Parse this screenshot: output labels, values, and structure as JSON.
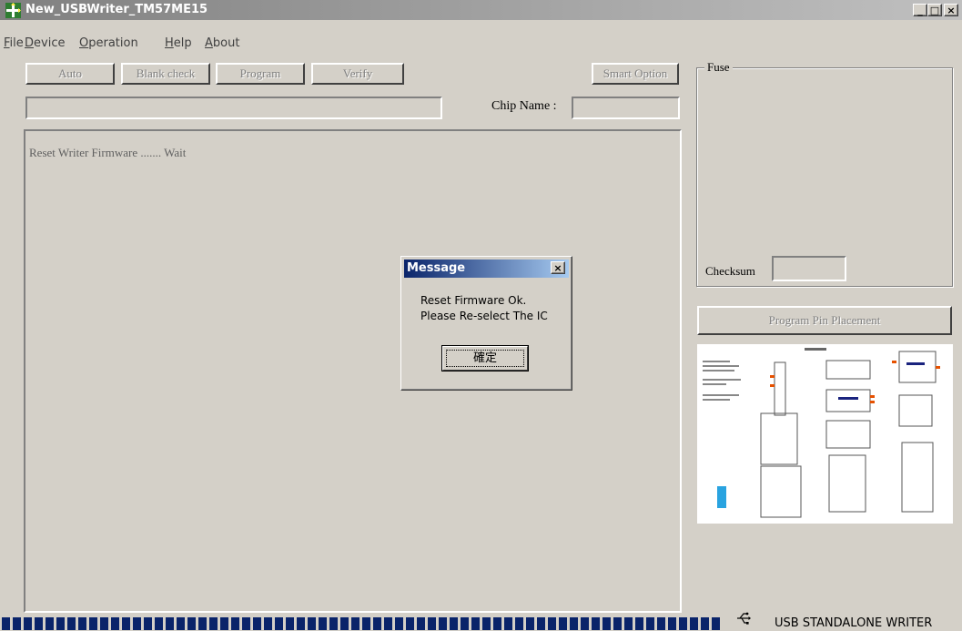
{
  "window": {
    "title": "New_USBWriter_TM57ME15",
    "controls": {
      "minimize": "_",
      "maximize": "□",
      "close": "×"
    }
  },
  "menu": [
    {
      "label": "File",
      "accel": "F",
      "rest": "ile"
    },
    {
      "label": "Device",
      "accel": "D",
      "rest": "evice"
    },
    {
      "label": "Operation",
      "accel": "O",
      "rest": "peration"
    },
    {
      "label": "Help",
      "accel": "H",
      "rest": "elp"
    },
    {
      "label": "About",
      "accel": "A",
      "rest": "bout"
    }
  ],
  "toolbar": {
    "auto": "Auto",
    "blank_check": "Blank check",
    "program": "Program",
    "verify": "Verify",
    "smart_option": "Smart Option"
  },
  "chip": {
    "label": "Chip Name :",
    "value": ""
  },
  "status_field": {
    "value": ""
  },
  "log": {
    "text": "Reset Writer Firmware ....... Wait"
  },
  "fuse": {
    "title": "Fuse",
    "checksum_label": "Checksum",
    "checksum_value": ""
  },
  "pin_placement": {
    "label": "Program Pin Placement"
  },
  "dialog": {
    "title": "Message",
    "line1": "Reset Firmware Ok.",
    "line2": "Please Re-select The IC",
    "ok_label": "確定"
  },
  "statusbar": {
    "progress_fraction": 1.0,
    "mode_text": "USB STANDALONE WRITER",
    "usb_icon": "usb-icon"
  },
  "colors": {
    "titlebar_start": "#808080",
    "titlebar_end": "#c0c0c0",
    "dialog_title_start": "#0a246a",
    "dialog_title_end": "#a6caf0",
    "progress": "#0a246a"
  }
}
